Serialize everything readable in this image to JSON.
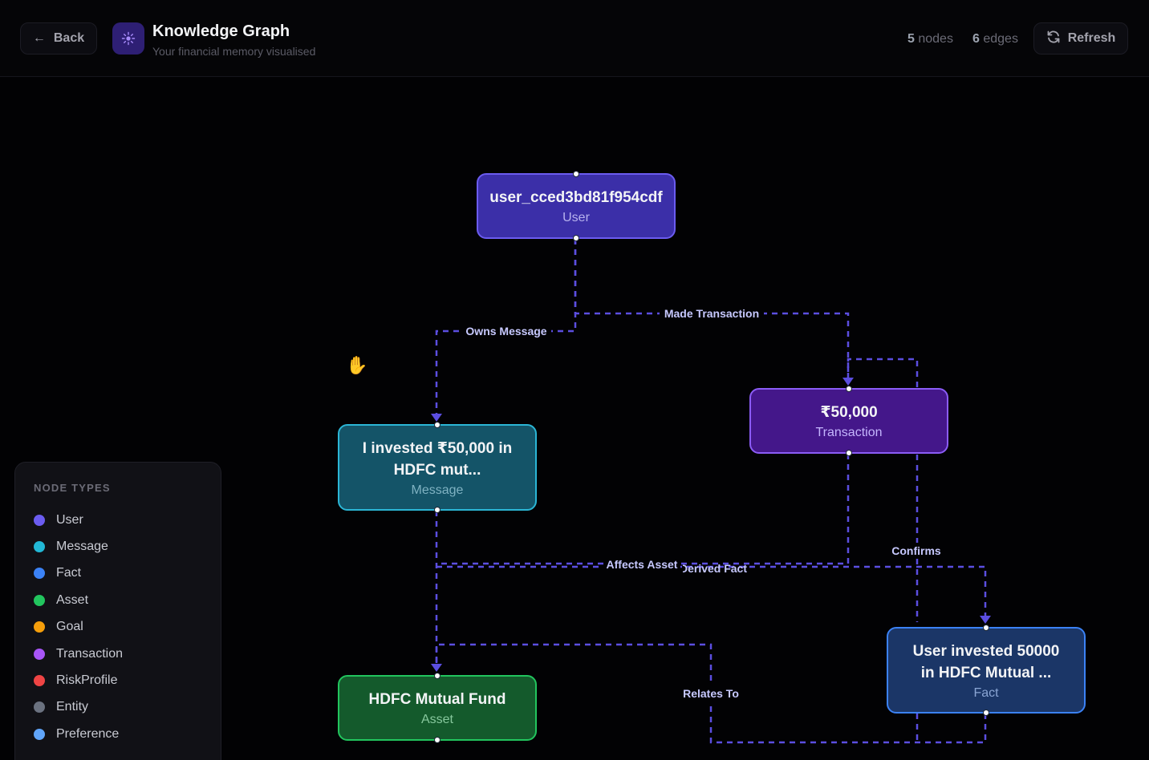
{
  "header": {
    "back_label": "Back",
    "title": "Knowledge Graph",
    "subtitle": "Your financial memory visualised",
    "nodes_count": "5",
    "nodes_label": "nodes",
    "edges_count": "6",
    "edges_label": "edges",
    "refresh_label": "Refresh"
  },
  "nodes": {
    "user": {
      "label": "user_cced3bd81f954cdf",
      "type": "User"
    },
    "message": {
      "label_line1": "I invested ₹50,000 in",
      "label_line2": "HDFC mut...",
      "type": "Message"
    },
    "transaction": {
      "label": "₹50,000",
      "type": "Transaction"
    },
    "asset": {
      "label": "HDFC Mutual Fund",
      "type": "Asset"
    },
    "fact": {
      "label_line1": "User invested 50000",
      "label_line2": "in HDFC Mutual ...",
      "type": "Fact"
    }
  },
  "edges": {
    "owns_message": "Owns Message",
    "made_transaction": "Made Transaction",
    "affects_asset": "Affects Asset",
    "derived_fact": "Derived Fact",
    "confirms": "Confirms",
    "relates_to": "Relates To"
  },
  "legend": {
    "title": "NODE TYPES",
    "items": [
      {
        "label": "User",
        "color": "#6b5cf0"
      },
      {
        "label": "Message",
        "color": "#22b8d6"
      },
      {
        "label": "Fact",
        "color": "#3b82f6"
      },
      {
        "label": "Asset",
        "color": "#22c55e"
      },
      {
        "label": "Goal",
        "color": "#f59e0b"
      },
      {
        "label": "Transaction",
        "color": "#a855f7"
      },
      {
        "label": "RiskProfile",
        "color": "#ef4444"
      },
      {
        "label": "Entity",
        "color": "#6b7280"
      },
      {
        "label": "Preference",
        "color": "#60a5fa"
      }
    ]
  },
  "colors": {
    "edge": "#5b4ee0",
    "edge_label": "#c7c9ff",
    "background": "#020204"
  }
}
